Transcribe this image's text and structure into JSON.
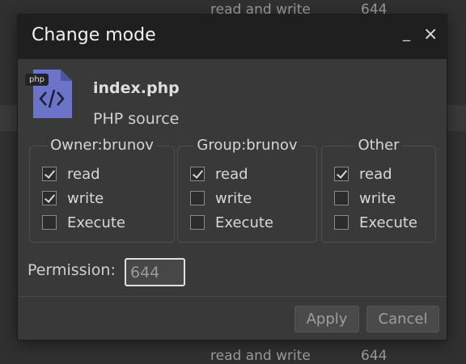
{
  "background": {
    "top_text_perm": "read and write",
    "top_text_value": "644",
    "bottom_text_perm": "read and write",
    "bottom_text_value": "644"
  },
  "dialog": {
    "title": "Change mode",
    "minimize_label": "_",
    "close_label": "×",
    "file": {
      "badge": "php",
      "name": "index.php",
      "type": "PHP source",
      "icon": "php-file-icon",
      "icon_color": "#6b74c8"
    },
    "groups": [
      {
        "title": "Owner:brunov",
        "options": [
          {
            "label": "read",
            "checked": true
          },
          {
            "label": "write",
            "checked": true
          },
          {
            "label": "Execute",
            "checked": false
          }
        ]
      },
      {
        "title": "Group:brunov",
        "options": [
          {
            "label": "read",
            "checked": true
          },
          {
            "label": "write",
            "checked": false
          },
          {
            "label": "Execute",
            "checked": false
          }
        ]
      },
      {
        "title": "Other",
        "options": [
          {
            "label": "read",
            "checked": true
          },
          {
            "label": "write",
            "checked": false
          },
          {
            "label": "Execute",
            "checked": false
          }
        ]
      }
    ],
    "permission": {
      "label": "Permission:",
      "value": "644"
    },
    "buttons": {
      "apply": "Apply",
      "cancel": "Cancel"
    }
  }
}
